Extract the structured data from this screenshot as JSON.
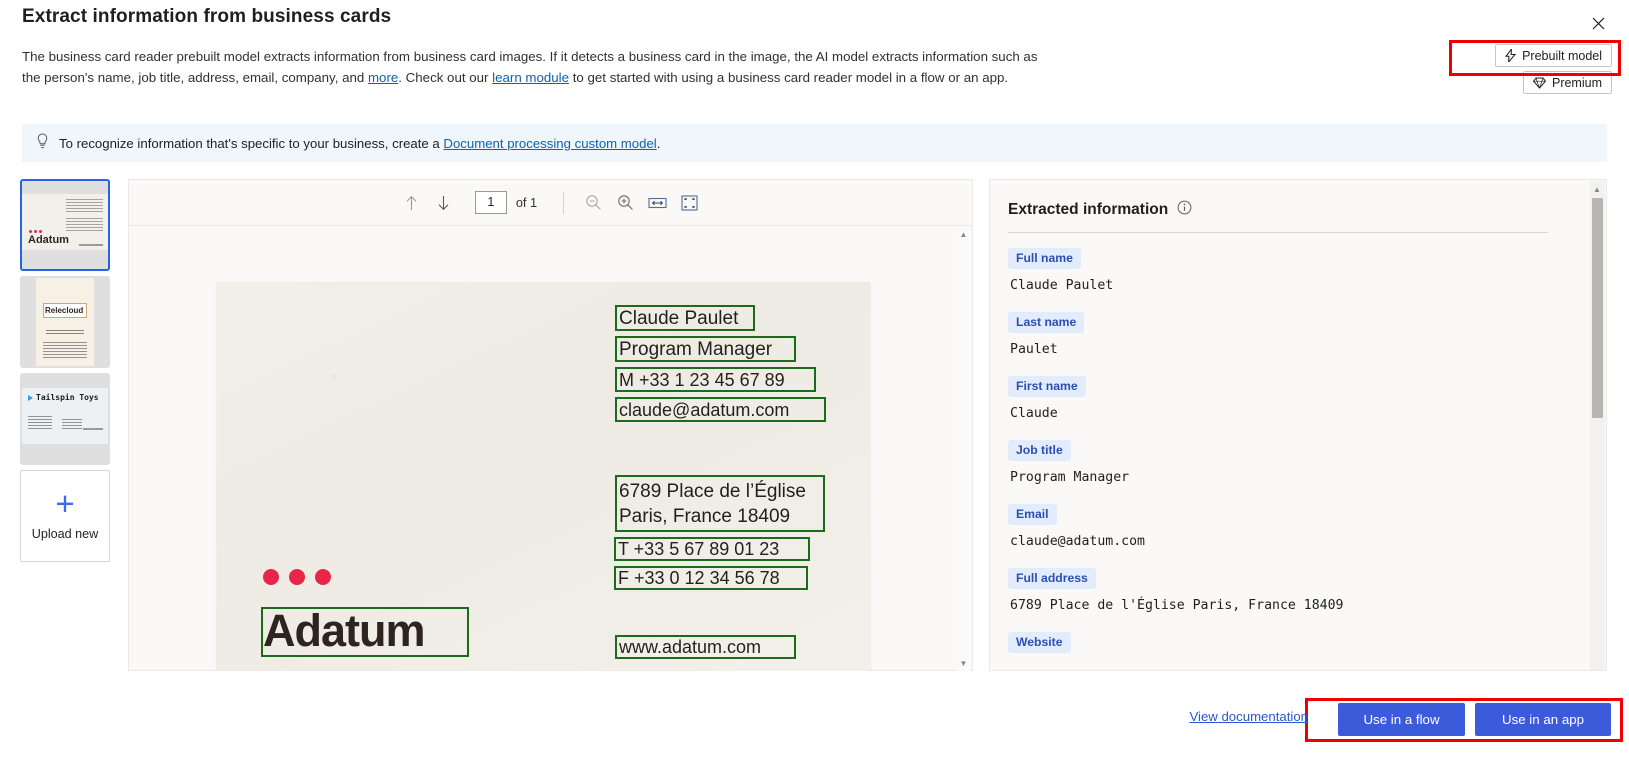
{
  "header": {
    "title": "Extract information from business cards",
    "close_icon": "close-icon",
    "description_part1": "The business card reader prebuilt model extracts information from business card images. If it detects a business card in the image, the AI model extracts information such as the person's name, job title, address, email, company, and ",
    "link_more": "more",
    "description_part2": ". Check out our ",
    "link_learn": "learn module",
    "description_part3": " to get started with using a business card reader model in a flow or an app."
  },
  "badges": [
    {
      "label": "Prebuilt model",
      "icon": "lightning-icon",
      "highlighted": true
    },
    {
      "label": "Premium",
      "icon": "diamond-icon",
      "highlighted": false
    }
  ],
  "banner": {
    "icon": "lightbulb-icon",
    "text_before": "To recognize information that's specific to your business, create a ",
    "link": "Document processing custom model",
    "text_after": "."
  },
  "thumbnails": {
    "items": [
      {
        "name": "Adatum",
        "selected": true
      },
      {
        "name": "Relecloud",
        "selected": false
      },
      {
        "name": "Tailspin Toys",
        "selected": false
      }
    ],
    "upload": {
      "label": "Upload new",
      "icon": "plus-icon"
    }
  },
  "viewer": {
    "toolbar": {
      "previous_icon": "arrow-up-icon",
      "next_icon": "arrow-down-icon",
      "page_value": "1",
      "page_total": "of 1",
      "zoom_out_icon": "zoom-out-icon",
      "zoom_in_icon": "zoom-in-icon",
      "fit_width_icon": "fit-width-icon",
      "fit_page_icon": "fit-page-icon"
    },
    "card": {
      "company": "Adatum",
      "ocr_lines": [
        "Claude Paulet",
        "Program Manager",
        "M +33 1 23 45 67 89",
        "claude@adatum.com",
        "6789 Place de l’Église",
        "Paris, France 18409",
        "T +33 5 67 89 01 23",
        "F +33 0 12 34 56 78",
        "www.adatum.com"
      ]
    }
  },
  "extracted": {
    "title": "Extracted information",
    "info_icon": "info-circle-icon",
    "fields": [
      {
        "label": "Full name",
        "value": "Claude Paulet"
      },
      {
        "label": "Last name",
        "value": "Paulet"
      },
      {
        "label": "First name",
        "value": "Claude"
      },
      {
        "label": "Job title",
        "value": "Program Manager"
      },
      {
        "label": "Email",
        "value": "claude@adatum.com"
      },
      {
        "label": "Full address",
        "value": "6789 Place de l'Église Paris, France 18409"
      },
      {
        "label": "Website",
        "value": ""
      }
    ]
  },
  "footer": {
    "documentation_link": "View documentation",
    "use_in_flow": "Use in a flow",
    "use_in_app": "Use in an app"
  },
  "colors": {
    "accent": "#3b5bdb",
    "link": "#0f62b0",
    "pill_bg": "#e3ecfd",
    "pill_text": "#2b4fb0",
    "banner_bg": "#eff6fc",
    "ocr_box": "#1a6b1a",
    "highlight": "#ee0000",
    "selected_thumb": "#2563eb"
  }
}
